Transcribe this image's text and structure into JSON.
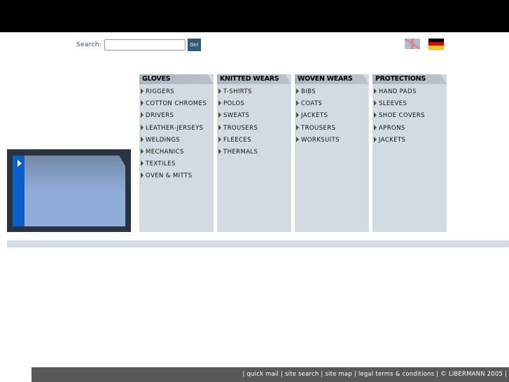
{
  "search": {
    "label": "Search:",
    "value": "",
    "placeholder": "",
    "button": "Go!"
  },
  "languages": [
    {
      "name": "english",
      "icon": "uk-flag-icon"
    },
    {
      "name": "deutsch",
      "icon": "german-flag-icon"
    }
  ],
  "menu": [
    {
      "title": "GLOVES",
      "items": [
        "RIGGERS",
        "COTTON CHROMES",
        "DRIVERS",
        "LEATHER-JERSEYS",
        "WELDINGS",
        "MECHANICS",
        "TEXTILES",
        "OVEN & MITTS"
      ]
    },
    {
      "title": "KNITTED WEARS",
      "items": [
        "T-SHIRTS",
        "POLOS",
        "SWEATS",
        "TROUSERS",
        "FLEECES",
        "THERMALS"
      ]
    },
    {
      "title": "WOVEN WEARS",
      "items": [
        "BIBS",
        "COATS",
        "JACKETS",
        "TROUSERS",
        "WORKSUITS"
      ]
    },
    {
      "title": "PROTECTIONS",
      "items": [
        "HAND PADS",
        "SLEEVES",
        "SHOE COVERS",
        "APRONS",
        "JACKETS"
      ]
    }
  ],
  "footer": {
    "sep": "|",
    "links": [
      "quick mail",
      "site search",
      "site map",
      "legal terms & conditions"
    ],
    "copyright": "© LIBERMANN 2005"
  }
}
